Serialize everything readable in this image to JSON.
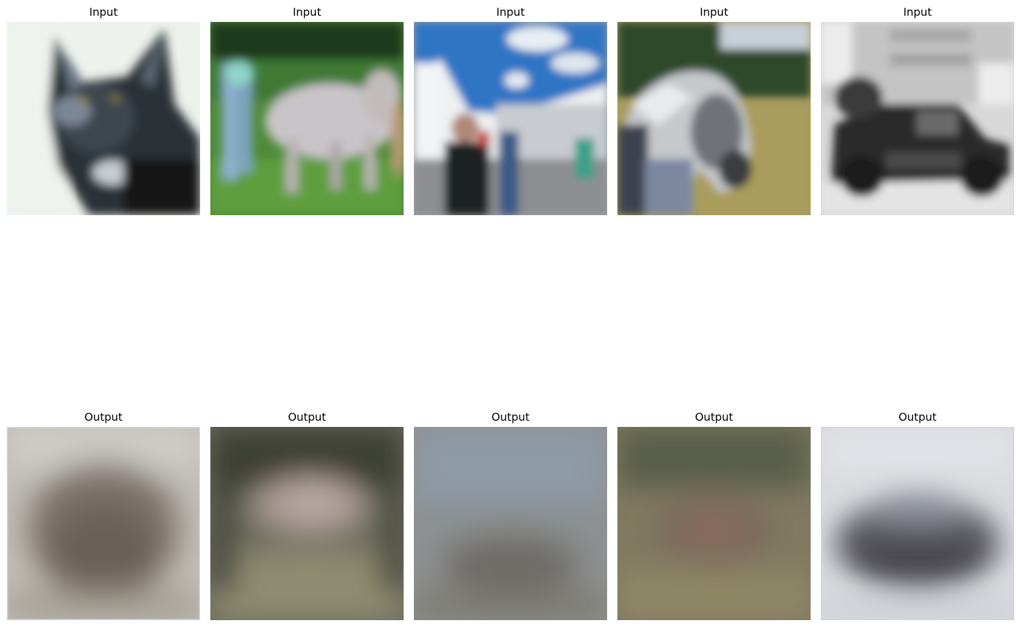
{
  "figure": {
    "rows": [
      {
        "role": "input",
        "panels": [
          {
            "title": "Input",
            "subject": "cat"
          },
          {
            "title": "Input",
            "subject": "horse"
          },
          {
            "title": "Input",
            "subject": "airplane"
          },
          {
            "title": "Input",
            "subject": "horse"
          },
          {
            "title": "Input",
            "subject": "automobile"
          }
        ]
      },
      {
        "role": "output",
        "panels": [
          {
            "title": "Output",
            "subject": "reconstruction"
          },
          {
            "title": "Output",
            "subject": "reconstruction"
          },
          {
            "title": "Output",
            "subject": "reconstruction"
          },
          {
            "title": "Output",
            "subject": "reconstruction"
          },
          {
            "title": "Output",
            "subject": "reconstruction"
          }
        ]
      }
    ]
  }
}
